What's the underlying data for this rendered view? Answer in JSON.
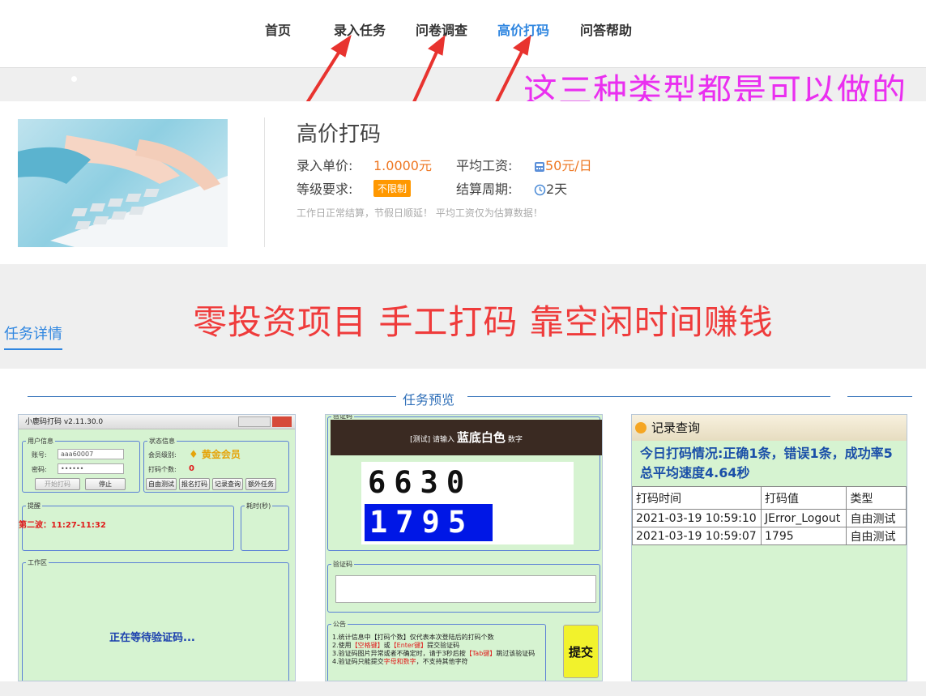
{
  "nav": {
    "items": [
      "首页",
      "录入任务",
      "问卷调查",
      "高价打码",
      "问答帮助"
    ],
    "active": "高价打码"
  },
  "callout": "这三种类型都是可以做的",
  "task": {
    "title": "高价打码",
    "unit_price_label": "录入单价:",
    "unit_price_value": "1.0000元",
    "avg_wage_label": "平均工资:",
    "avg_wage_value": "50元/日",
    "level_label": "等级要求:",
    "level_value": "不限制",
    "cycle_label": "结算周期:",
    "cycle_value": "2天",
    "note": "工作日正常结算，节假日顺延！ 平均工资仅为估算数据！"
  },
  "slogan": "零投资项目  手工打码  靠空闲时间赚钱",
  "detail_tab": "任务详情",
  "preview": {
    "title": "任务预览",
    "shot1": {
      "window_title": "小鹿码打码 v2.11.30.0",
      "user_group": "用户信息",
      "account_label": "账号:",
      "account_value": "aaa60007",
      "password_label": "密码:",
      "password_value": "••••••",
      "start_btn": "开始打码",
      "stop_btn": "停止",
      "status_group": "状态信息",
      "member_label": "会员级别:",
      "member_value": "黄金会员",
      "count_label": "打码个数:",
      "count_value": "0",
      "btn_free_test": "自由测试",
      "btn_signup": "报名打码",
      "btn_records": "记录查询",
      "btn_extra": "额外任务",
      "reminder_group": "提醒",
      "reminder_text": "第二波：11:27-11:32",
      "time_group": "耗时(秒)",
      "work_group": "工作区",
      "waiting_text": "正在等待验证码..."
    },
    "shot2": {
      "group_top": "验证码",
      "prompt_prefix": "[测试] 请输入",
      "prompt_main": "蓝底白色",
      "prompt_suffix": "数字",
      "captcha_row1": "6630",
      "captcha_row2": "1795",
      "code_group": "验证码",
      "notice_group": "公告",
      "notice_1": "1.统计信息中【打码个数】仅代表本次登陆后的打码个数",
      "notice_2a": "2.使用",
      "notice_2b": "【空格键】",
      "notice_2c": "或",
      "notice_2d": "【Enter键】",
      "notice_2e": "提交验证码",
      "notice_3a": "3.验证码图片异常或者不确定时，请于3秒后按",
      "notice_3b": "【Tab键】",
      "notice_3c": "跳过该验证码",
      "notice_4a": "4.验证码只能提交",
      "notice_4b": "字母和数字",
      "notice_4c": "，不支持其他字符",
      "submit": "提交"
    },
    "shot3": {
      "title": "记录查询",
      "summary_1": "今日打码情况:正确1条，错误1条，成功率5",
      "summary_2": "总平均速度4.64秒",
      "columns": [
        "打码时间",
        "打码值",
        "类型"
      ],
      "rows": [
        [
          "2021-03-19 10:59:10",
          "JError_Logout",
          "自由测试"
        ],
        [
          "2021-03-19 10:59:07",
          "1795",
          "自由测试"
        ]
      ]
    }
  },
  "colors": {
    "accent_blue": "#2f86e0",
    "price_orange": "#ee7722",
    "callout_magenta": "#ea2ff0",
    "slogan_red": "#ef3b3b",
    "arrow_red": "#e8332f"
  }
}
